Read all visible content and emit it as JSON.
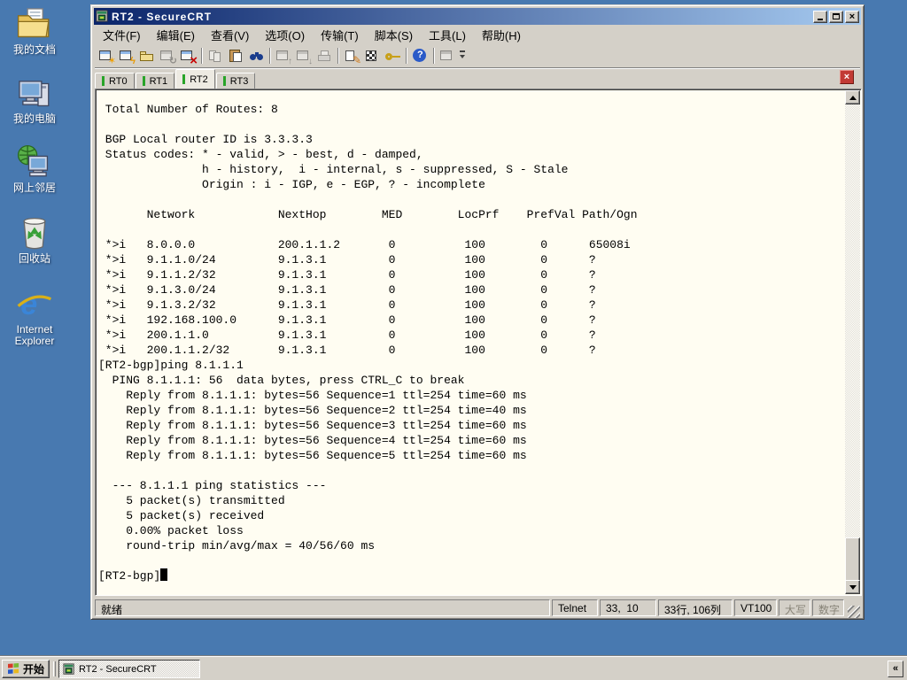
{
  "desktop": {
    "icons": [
      {
        "name": "my-documents",
        "label": "我的文档"
      },
      {
        "name": "my-computer",
        "label": "我的电脑"
      },
      {
        "name": "network-places",
        "label": "网上邻居"
      },
      {
        "name": "recycle-bin",
        "label": "回收站"
      },
      {
        "name": "internet-explorer",
        "label": "Internet Explorer"
      }
    ]
  },
  "window": {
    "title": "RT2 - SecureCRT",
    "menu": [
      {
        "name": "file",
        "label": "文件(F)"
      },
      {
        "name": "edit",
        "label": "编辑(E)"
      },
      {
        "name": "view",
        "label": "查看(V)"
      },
      {
        "name": "options",
        "label": "选项(O)"
      },
      {
        "name": "transfer",
        "label": "传输(T)"
      },
      {
        "name": "script",
        "label": "脚本(S)"
      },
      {
        "name": "tools",
        "label": "工具(L)"
      },
      {
        "name": "help",
        "label": "帮助(H)"
      }
    ],
    "toolbar": [
      {
        "name": "new-session",
        "enabled": true
      },
      {
        "name": "quick-connect",
        "enabled": true
      },
      {
        "name": "connect",
        "enabled": true
      },
      {
        "name": "reconnect",
        "enabled": false
      },
      {
        "name": "disconnect",
        "enabled": true
      },
      {
        "sep": true
      },
      {
        "name": "copy",
        "enabled": false
      },
      {
        "name": "paste",
        "enabled": true
      },
      {
        "name": "find",
        "enabled": true
      },
      {
        "sep": true
      },
      {
        "name": "zmodem-upload",
        "enabled": false
      },
      {
        "name": "zmodem-download",
        "enabled": false
      },
      {
        "name": "print",
        "enabled": false
      },
      {
        "sep": true
      },
      {
        "name": "session-options",
        "enabled": true
      },
      {
        "name": "keymap",
        "enabled": true
      },
      {
        "name": "key",
        "enabled": true
      },
      {
        "sep": true
      },
      {
        "name": "help",
        "enabled": true
      },
      {
        "sep": true
      },
      {
        "name": "session-window",
        "enabled": false
      }
    ],
    "tabs": [
      {
        "label": "RT0",
        "active": false
      },
      {
        "label": "RT1",
        "active": false
      },
      {
        "label": "RT2",
        "active": true
      },
      {
        "label": "RT3",
        "active": false
      }
    ],
    "terminal": {
      "lines": [
        " Total Number of Routes: 8",
        "",
        " BGP Local router ID is 3.3.3.3",
        " Status codes: * - valid, > - best, d - damped,",
        "               h - history,  i - internal, s - suppressed, S - Stale",
        "               Origin : i - IGP, e - EGP, ? - incomplete",
        "",
        "       Network            NextHop        MED        LocPrf    PrefVal Path/Ogn",
        "",
        " *>i   8.0.0.0            200.1.1.2       0          100        0      65008i",
        " *>i   9.1.1.0/24         9.1.3.1         0          100        0      ?",
        " *>i   9.1.1.2/32         9.1.3.1         0          100        0      ?",
        " *>i   9.1.3.0/24         9.1.3.1         0          100        0      ?",
        " *>i   9.1.3.2/32         9.1.3.1         0          100        0      ?",
        " *>i   192.168.100.0      9.1.3.1         0          100        0      ?",
        " *>i   200.1.1.0          9.1.3.1         0          100        0      ?",
        " *>i   200.1.1.2/32       9.1.3.1         0          100        0      ?",
        "[RT2-bgp]ping 8.1.1.1",
        "  PING 8.1.1.1: 56  data bytes, press CTRL_C to break",
        "    Reply from 8.1.1.1: bytes=56 Sequence=1 ttl=254 time=60 ms",
        "    Reply from 8.1.1.1: bytes=56 Sequence=2 ttl=254 time=40 ms",
        "    Reply from 8.1.1.1: bytes=56 Sequence=3 ttl=254 time=60 ms",
        "    Reply from 8.1.1.1: bytes=56 Sequence=4 ttl=254 time=60 ms",
        "    Reply from 8.1.1.1: bytes=56 Sequence=5 ttl=254 time=60 ms",
        "",
        "  --- 8.1.1.1 ping statistics ---",
        "    5 packet(s) transmitted",
        "    5 packet(s) received",
        "    0.00% packet loss",
        "    round-trip min/avg/max = 40/56/60 ms",
        ""
      ],
      "prompt": "[RT2-bgp]"
    },
    "statusbar": {
      "ready": "就绪",
      "protocol": "Telnet",
      "cursor_pos": "33,  10",
      "screen_size": "33行, 106列",
      "emulation": "VT100",
      "caps": "大写",
      "num": "数字"
    }
  },
  "taskbar": {
    "start_label": "开始",
    "task_label": "RT2 - SecureCRT",
    "chevron": "«"
  },
  "colors": {
    "desktop": "#4879B0",
    "title_gradient_start": "#0A246A",
    "title_gradient_end": "#A6CAF0",
    "window_face": "#D4D0C8",
    "terminal_bg": "#FFFDF2",
    "terminal_text": "#000000",
    "tab_connected_indicator": "#28A428",
    "tab_close": "#C23A34",
    "disabled_text": "#888478"
  }
}
